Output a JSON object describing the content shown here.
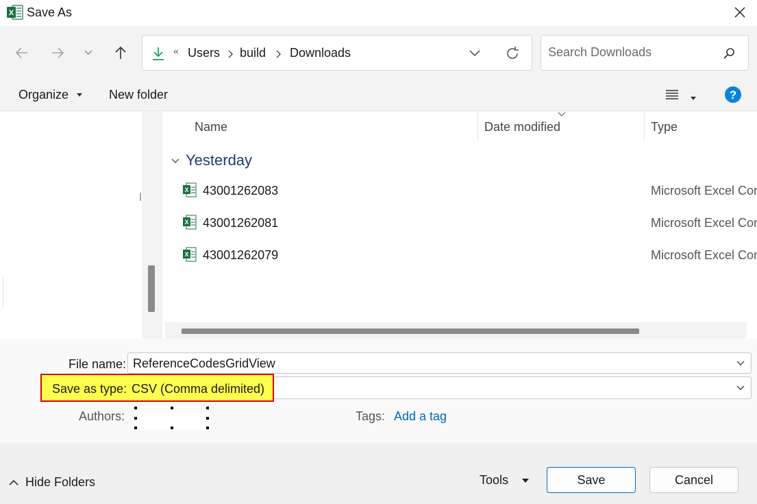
{
  "window": {
    "title": "Save As",
    "app_icon": "excel-icon"
  },
  "nav": {
    "back_icon": "arrow-left-icon",
    "forward_icon": "arrow-right-icon",
    "recent_icon": "chevron-down-icon",
    "up_icon": "arrow-up-icon",
    "breadcrumb": [
      "Users",
      "build",
      "Downloads"
    ],
    "overflow": "«",
    "search_placeholder": "Search Downloads"
  },
  "toolbar": {
    "organize_label": "Organize",
    "new_folder_label": "New folder"
  },
  "columns": {
    "name": "Name",
    "date_modified": "Date modified",
    "type": "Type"
  },
  "group_label": "Yesterday",
  "files": [
    {
      "name": "43001262083",
      "type": "Microsoft Excel Con"
    },
    {
      "name": "43001262081",
      "type": "Microsoft Excel Con"
    },
    {
      "name": "43001262079",
      "type": "Microsoft Excel Con"
    }
  ],
  "form": {
    "file_name_label": "File name:",
    "file_name_value": "ReferenceCodesGridView",
    "save_as_type_label": "Save as type:",
    "save_as_type_value": "CSV (Comma delimited)",
    "authors_label": "Authors:",
    "tags_label": "Tags:",
    "add_tag_label": "Add a tag"
  },
  "footer": {
    "hide_folders_label": "Hide Folders",
    "tools_label": "Tools",
    "save_label": "Save",
    "cancel_label": "Cancel"
  },
  "colors": {
    "accent": "#0067c0",
    "highlight": "#ffff4d",
    "highlight_border": "#e00000",
    "group_text": "#1e3a78",
    "excel_green": "#1d6f42"
  }
}
